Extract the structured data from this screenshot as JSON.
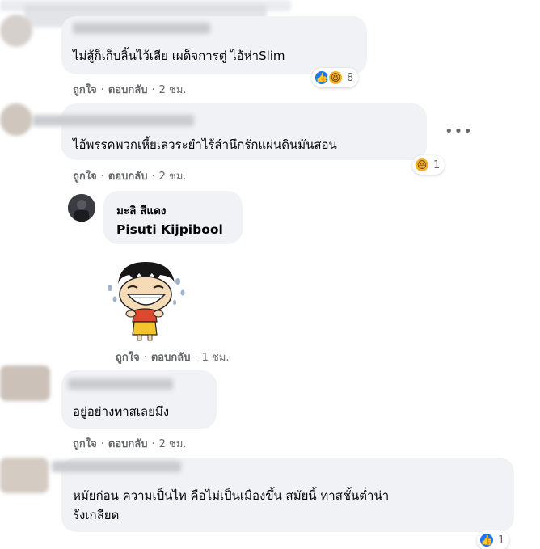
{
  "comments": [
    {
      "text": "ไม่สู้ก็เก็บลิ้นไว้เลีย เผด็จการตู่ ไอ้ห่าSlim",
      "actions": {
        "like": "ถูกใจ",
        "reply": "ตอบกลับ",
        "time": "2 ชม."
      },
      "reaction_count": "8",
      "reactions": [
        "like-icon",
        "haha-icon"
      ]
    },
    {
      "text": "ไอ้พรรคพวกเหี้ยเลวระยำไร้สำนึกรักแผ่นดินมันสอน",
      "actions": {
        "like": "ถูกใจ",
        "reply": "ตอบกลับ",
        "time": "2 ชม."
      },
      "reaction_count": "1",
      "reactions": [
        "haha-icon"
      ],
      "reply": {
        "author": "มะลิ สีแดง",
        "mention": "Pisuti Kijpibool",
        "sticker": "laughing-crying-sticker",
        "actions": {
          "like": "ถูกใจ",
          "reply": "ตอบกลับ",
          "time": "1 ชม."
        }
      }
    },
    {
      "text": "อยู่อย่างทาสเลยมึง",
      "actions": {
        "like": "ถูกใจ",
        "reply": "ตอบกลับ",
        "time": "2 ชม."
      }
    },
    {
      "text_line1": "หมัยก่อน ความเป็นไท คือไม่เป็นเมืองขึ้น สมัยนี้ ทาสชั้นต่ำน่า",
      "text_line2": "รังเกลียด",
      "reaction_count": "1",
      "reactions": [
        "like-icon"
      ]
    }
  ],
  "separator": "·",
  "colors": {
    "bubble": "#f0f2f5",
    "meta": "#65676b",
    "like": "#1877f2",
    "haha": "#f7b125"
  }
}
